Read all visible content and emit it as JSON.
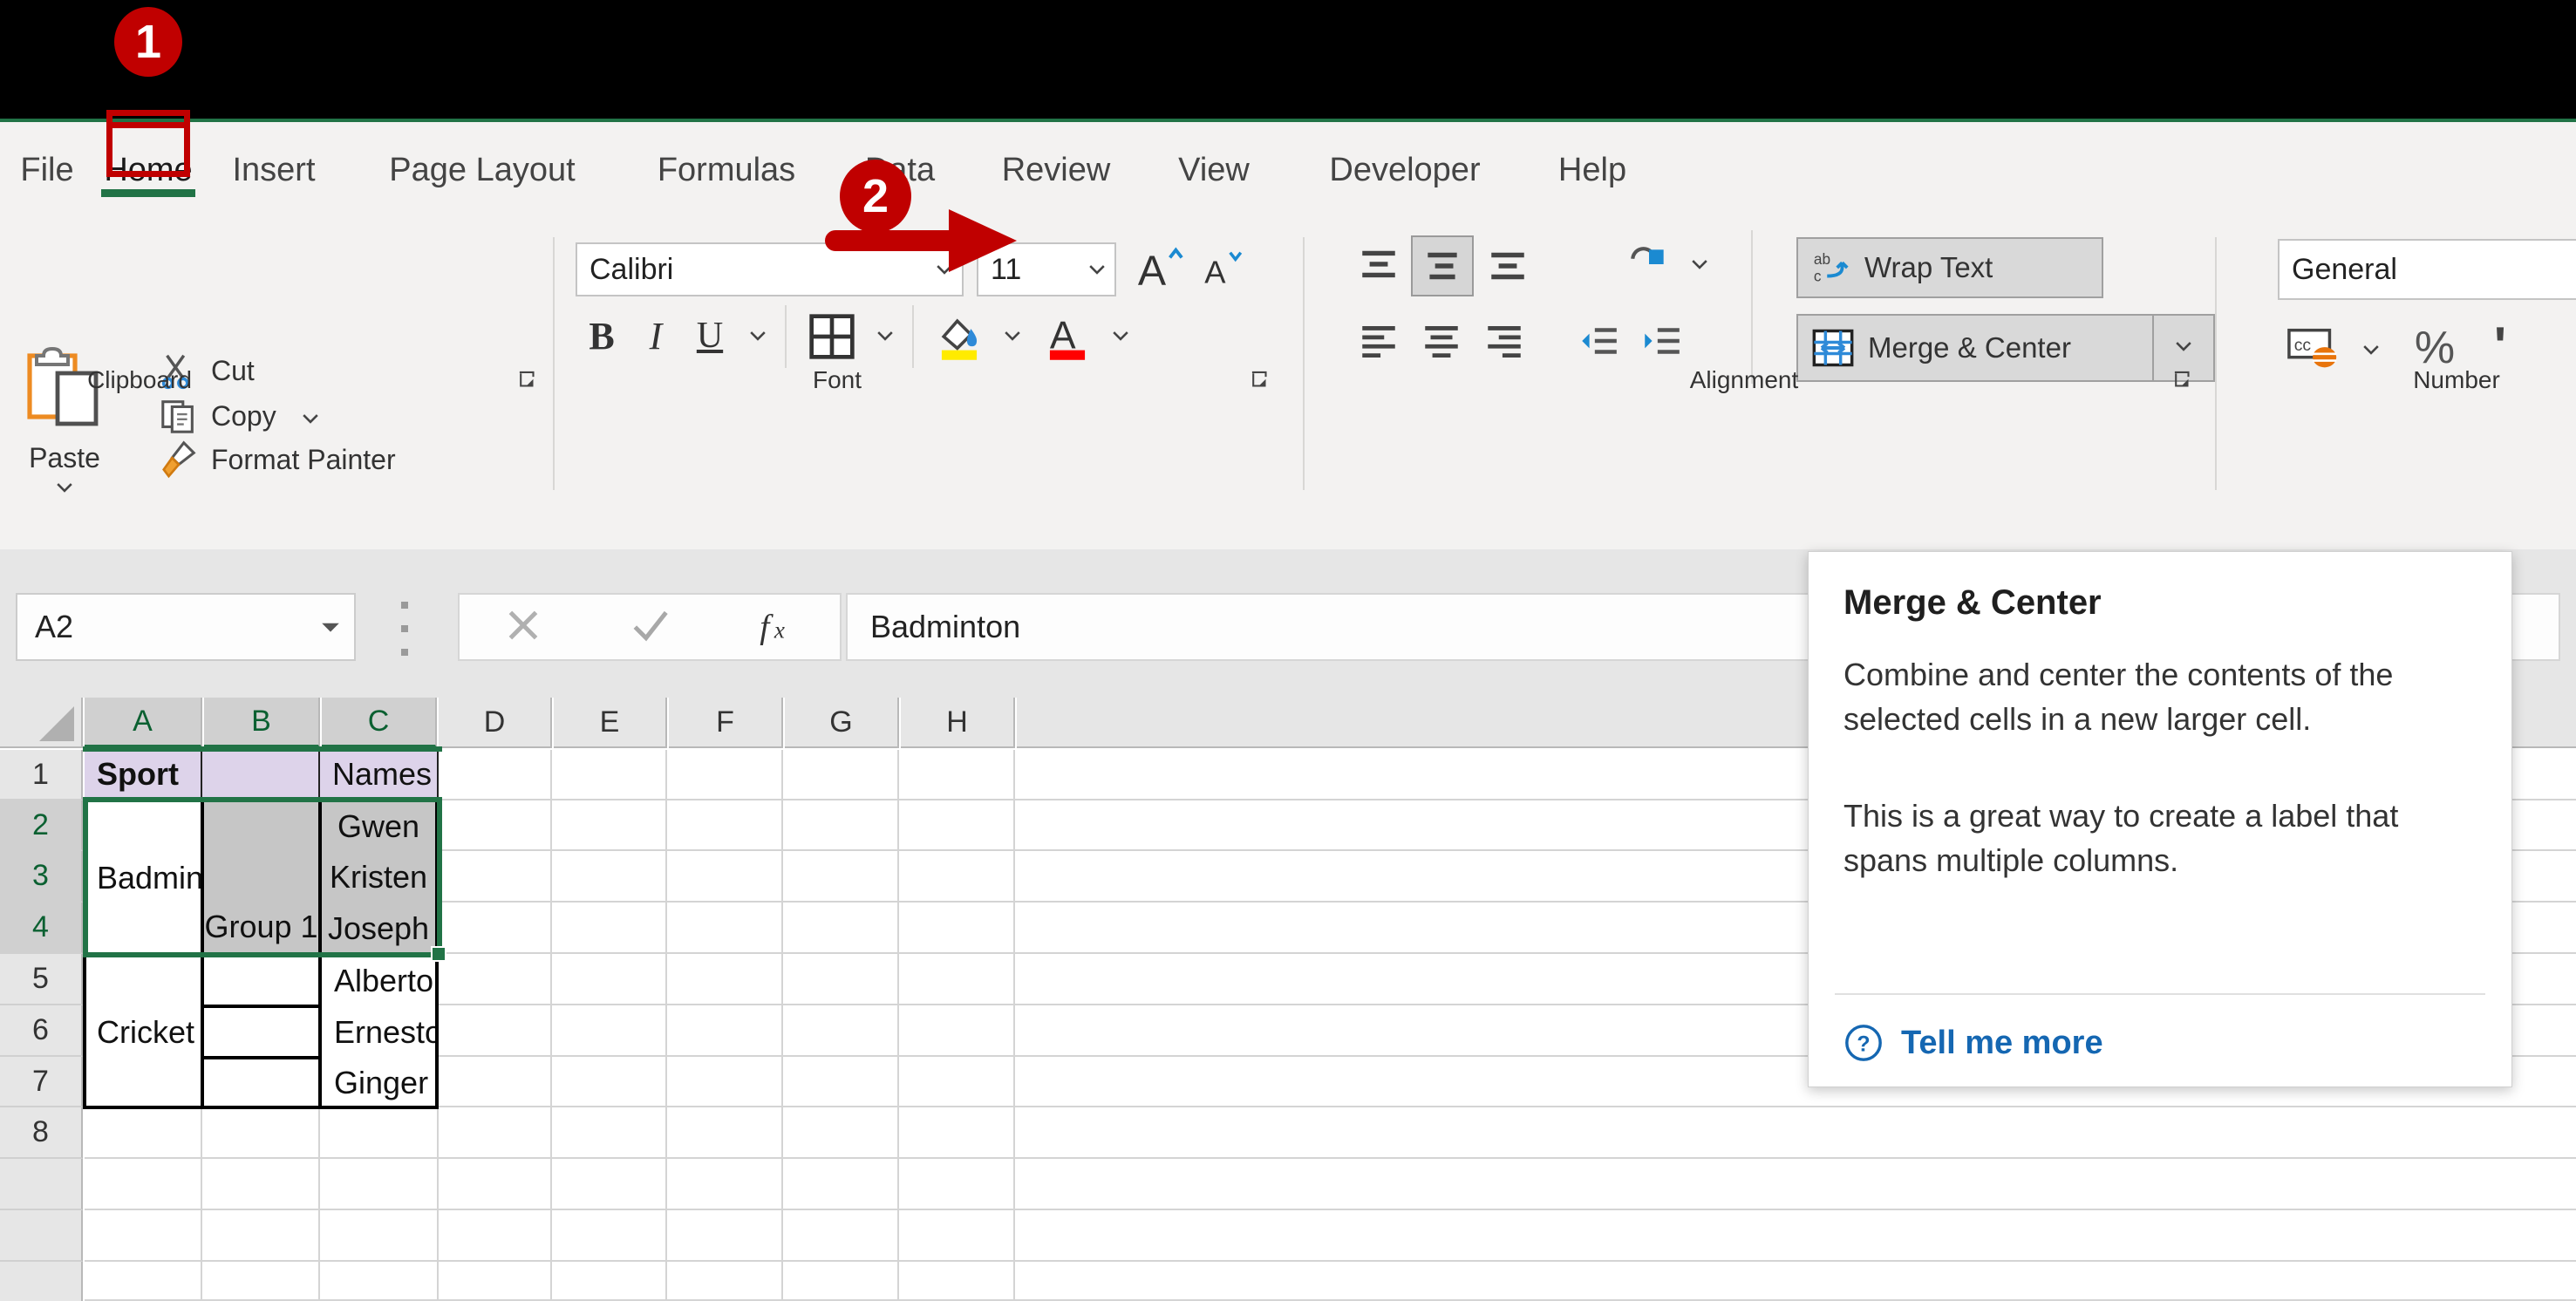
{
  "app": {
    "name": "Microsoft Excel"
  },
  "callouts": [
    {
      "number": "1",
      "target": "home-tab"
    },
    {
      "number": "2",
      "target": "merge-and-center-button"
    }
  ],
  "ribbon": {
    "tabs": [
      {
        "label": "File",
        "active": false
      },
      {
        "label": "Home",
        "active": true
      },
      {
        "label": "Insert",
        "active": false
      },
      {
        "label": "Page Layout",
        "active": false
      },
      {
        "label": "Formulas",
        "active": false
      },
      {
        "label": "Data",
        "active": false
      },
      {
        "label": "Review",
        "active": false
      },
      {
        "label": "View",
        "active": false
      },
      {
        "label": "Developer",
        "active": false
      },
      {
        "label": "Help",
        "active": false
      }
    ],
    "groups": {
      "clipboard": {
        "label": "Clipboard",
        "paste_label": "Paste",
        "cut_label": "Cut",
        "copy_label": "Copy",
        "format_painter_label": "Format Painter"
      },
      "font": {
        "label": "Font",
        "font_family_value": "Calibri",
        "font_size_value": "11",
        "grow_font_icon": "grow-font-icon",
        "shrink_font_icon": "shrink-font-icon",
        "bold_label": "B",
        "italic_label": "I",
        "underline_label": "U",
        "borders_icon": "borders-icon",
        "fill_color_icon": "fill-color-icon",
        "fill_color": "#ffeb00",
        "font_color_icon": "font-color-icon",
        "font_color": "#ff0000"
      },
      "alignment": {
        "label": "Alignment",
        "align_top_icon": "align-top-icon",
        "align_middle_icon": "align-middle-icon",
        "align_bottom_icon": "align-bottom-icon",
        "align_left_icon": "align-left-icon",
        "align_center_icon": "align-center-icon",
        "align_right_icon": "align-right-icon",
        "orientation_icon": "orientation-icon",
        "decrease_indent_icon": "decrease-indent-icon",
        "increase_indent_icon": "increase-indent-icon",
        "wrap_text_label": "Wrap Text",
        "merge_center_label": "Merge & Center"
      },
      "number": {
        "label": "Number",
        "format_value": "General",
        "accounting_icon": "accounting-format-icon",
        "percent_label": "%",
        "comma_label": "'"
      }
    }
  },
  "formula_bar": {
    "name_box_value": "A2",
    "cancel_icon": "cancel-icon",
    "enter_icon": "enter-checkmark-icon",
    "function_icon": "insert-function-icon",
    "formula_value": "Badminton"
  },
  "tooltip": {
    "title": "Merge & Center",
    "paragraph_1": "Combine and center the contents of the selected cells in a new larger cell.",
    "paragraph_2": "This is a great way to create a label that spans multiple columns.",
    "help_icon": "question-circle-icon",
    "link_label": "Tell me more"
  },
  "sheet": {
    "column_headers": [
      "A",
      "B",
      "C",
      "D",
      "E",
      "F",
      "G",
      "H"
    ],
    "row_headers": [
      "1",
      "2",
      "3",
      "4",
      "5",
      "6",
      "7",
      "8"
    ],
    "selection_range": "A2:C4",
    "cells": {
      "a1": "Sport",
      "b1": "",
      "c1": "Names",
      "a2_merged": "Badminton",
      "b2_merged": "Group 1",
      "c2": "Gwen",
      "c3": "Kristen",
      "c4": "Joseph",
      "a5_merged": "Cricket",
      "b5": "",
      "b6": "",
      "b7": "",
      "c5": "Alberto",
      "c6": "Ernesto",
      "c7": "Ginger"
    }
  },
  "colors": {
    "excel_green": "#217346",
    "callout_red": "#c00000",
    "header_fill": "#ddd3ea",
    "selection_shade": "#c6c6c6",
    "link_blue": "#1567b2"
  }
}
